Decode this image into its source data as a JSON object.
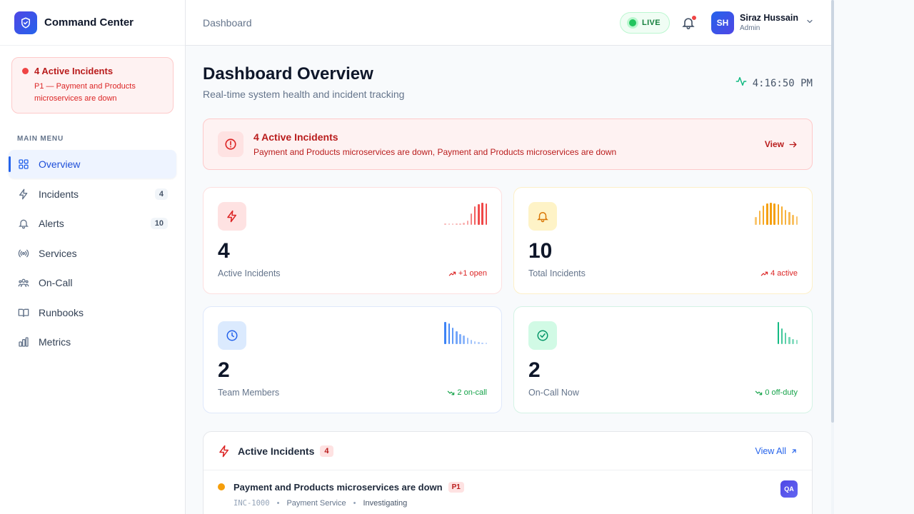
{
  "brand": {
    "name": "Command Center"
  },
  "sidebar": {
    "alert": {
      "title": "4 Active Incidents",
      "subtitle": "P1 — Payment and Products microservices are down"
    },
    "menu_label": "MAIN MENU",
    "items": [
      {
        "label": "Overview",
        "icon": "grid-icon",
        "active": true
      },
      {
        "label": "Incidents",
        "icon": "lightning-icon",
        "badge": "4"
      },
      {
        "label": "Alerts",
        "icon": "bell-icon",
        "badge": "10"
      },
      {
        "label": "Services",
        "icon": "broadcast-icon"
      },
      {
        "label": "On-Call",
        "icon": "users-icon"
      },
      {
        "label": "Runbooks",
        "icon": "book-icon"
      },
      {
        "label": "Metrics",
        "icon": "bar-chart-icon"
      }
    ]
  },
  "topbar": {
    "breadcrumb": "Dashboard",
    "live_label": "LIVE",
    "user": {
      "initials": "SH",
      "name": "Siraz Hussain",
      "role": "Admin"
    }
  },
  "header": {
    "title": "Dashboard Overview",
    "subtitle": "Real-time system health and incident tracking",
    "clock": "4:16:50 PM"
  },
  "banner": {
    "title": "4 Active Incidents",
    "subtitle": "Payment and Products microservices are down, Payment and Products microservices are down",
    "action": "View"
  },
  "stats": [
    {
      "value": "4",
      "label": "Active Incidents",
      "trend": "+1 open",
      "direction": "up",
      "accent": "#dc2626",
      "spark": [
        0.05,
        0.05,
        0.05,
        0.05,
        0.05,
        0.08,
        0.2,
        0.5,
        0.8,
        0.92,
        0.98,
        0.95
      ],
      "spark_color": "#ef4444"
    },
    {
      "value": "10",
      "label": "Total Incidents",
      "trend": "4 active",
      "direction": "up",
      "accent": "#dc2626",
      "spark": [
        0.35,
        0.62,
        0.85,
        0.95,
        0.98,
        0.95,
        0.9,
        0.8,
        0.65,
        0.55,
        0.45,
        0.38
      ],
      "spark_color": "#f59e0b"
    },
    {
      "value": "2",
      "label": "Team Members",
      "trend": "2 on-call",
      "direction": "down",
      "accent": "#16a34a",
      "spark": [
        0.98,
        0.9,
        0.72,
        0.55,
        0.45,
        0.36,
        0.28,
        0.2,
        0.14,
        0.08,
        0.06,
        0.05
      ],
      "spark_color": "#3b82f6"
    },
    {
      "value": "2",
      "label": "On-Call Now",
      "trend": "0 off-duty",
      "direction": "down",
      "accent": "#16a34a",
      "spark": [
        0.98,
        0.7,
        0.5,
        0.32,
        0.22,
        0.18
      ],
      "spark_color": "#10b981"
    }
  ],
  "incidents_panel": {
    "title": "Active Incidents",
    "count": "4",
    "view_all": "View All",
    "rows": [
      {
        "title": "Payment and Products microservices are down",
        "priority": "P1",
        "id": "INC-1000",
        "service": "Payment Service",
        "status": "Investigating",
        "assignee": "QA"
      }
    ]
  }
}
